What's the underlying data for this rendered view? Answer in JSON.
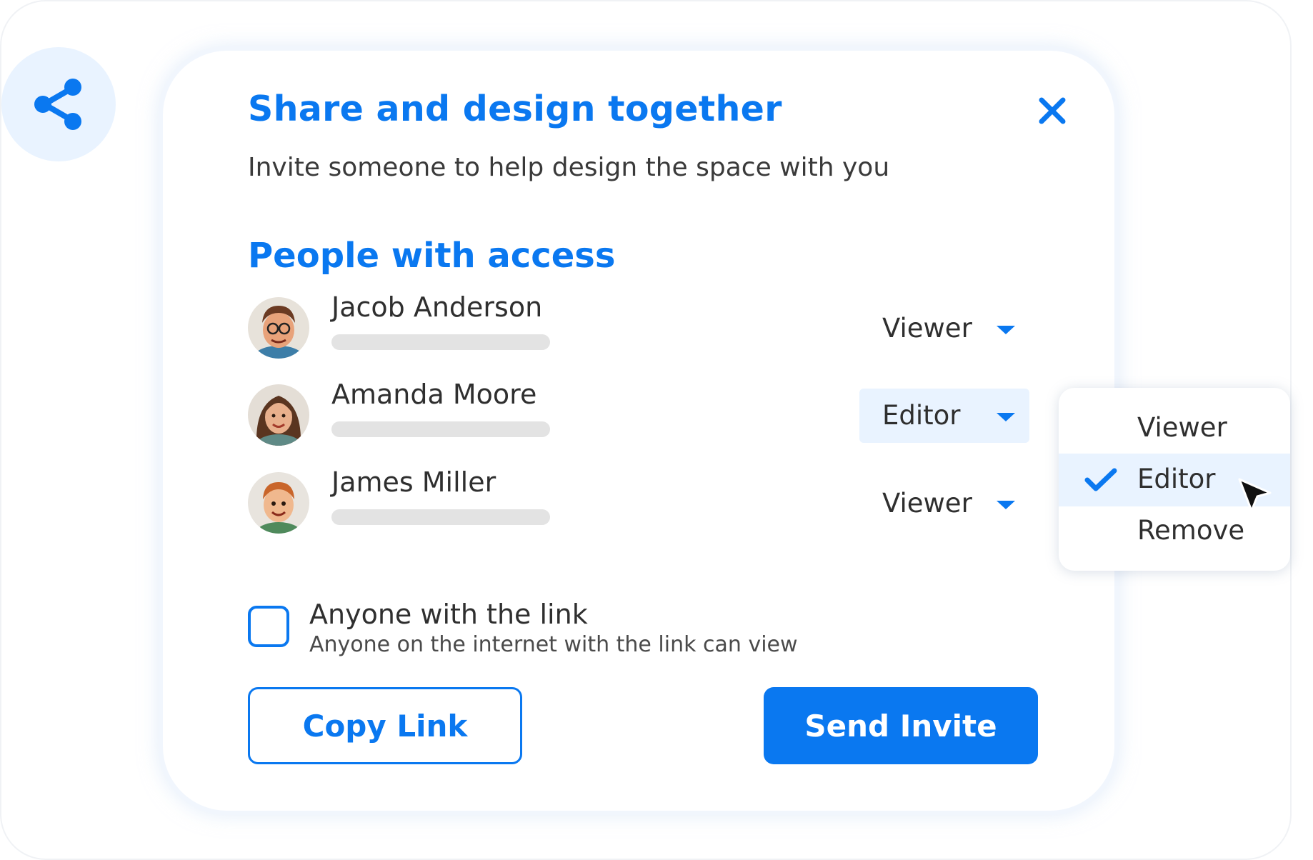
{
  "dialog": {
    "title": "Share and design together",
    "subtitle": "Invite someone to help design the space with you",
    "close_icon": "close-icon",
    "share_icon": "share-icon"
  },
  "access": {
    "section_title": "People with access",
    "people": [
      {
        "name": "Jacob Anderson",
        "role": "Viewer",
        "avatar": "avatar-jacob"
      },
      {
        "name": "Amanda Moore",
        "role": "Editor",
        "avatar": "avatar-amanda"
      },
      {
        "name": "James Miller",
        "role": "Viewer",
        "avatar": "avatar-james"
      }
    ]
  },
  "role_menu": {
    "options": [
      "Viewer",
      "Editor",
      "Remove"
    ],
    "selected": "Editor"
  },
  "link_sharing": {
    "title": "Anyone with the link",
    "description": "Anyone on the internet with the link can view",
    "checked": false
  },
  "buttons": {
    "copy_link": "Copy Link",
    "send_invite": "Send Invite"
  },
  "colors": {
    "accent": "#0a78f0",
    "accent_light": "#e9f3ff",
    "text": "#2f2f2f"
  }
}
